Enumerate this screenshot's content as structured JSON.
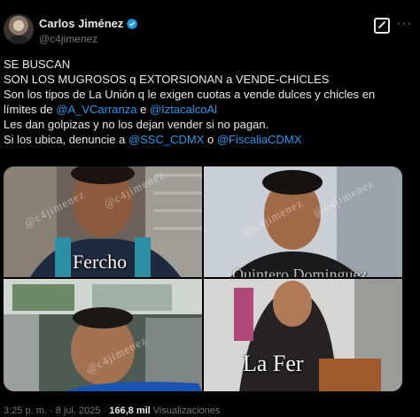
{
  "tweet": {
    "author": {
      "name": "Carlos Jiménez",
      "handle": "@c4jimenez"
    },
    "lines": [
      {
        "parts": [
          {
            "t": "SE BUSCAN",
            "link": false
          }
        ]
      },
      {
        "parts": [
          {
            "t": "SON LOS MUGROSOS q EXTORSIONAN a VENDE-CHICLES",
            "link": false
          }
        ]
      },
      {
        "parts": [
          {
            "t": "Son los tipos de La Unión q le exigen cuotas a vende dulces y chicles en",
            "link": false
          }
        ]
      },
      {
        "parts": [
          {
            "t": "límites de ",
            "link": false
          },
          {
            "t": "@A_VCarranza",
            "link": true
          },
          {
            "t": " e ",
            "link": false
          },
          {
            "t": "@IztacalcoAl",
            "link": true
          }
        ]
      },
      {
        "parts": [
          {
            "t": "Les dan golpizas y no los dejan vender si no pagan.",
            "link": false
          }
        ]
      },
      {
        "parts": [
          {
            "t": "Si los ubica, denuncie a ",
            "link": false
          },
          {
            "t": "@SSC_CDMX",
            "link": true
          },
          {
            "t": " o ",
            "link": false
          },
          {
            "t": "@FiscaliaCDMX",
            "link": true
          }
        ]
      }
    ],
    "photos": [
      {
        "caption": "Fercho",
        "watermark": "@c4jimenez"
      },
      {
        "caption": "Quintero Dominguez",
        "watermark": "@c4jimenez"
      },
      {
        "caption": "",
        "watermark": "@c4jimenez"
      },
      {
        "caption": "La Fer",
        "watermark": "@c4jimenez"
      }
    ],
    "meta": {
      "time": "3:25 p. m. · 8 jul. 2025 · ",
      "views": "166,8 mil",
      "views_label": " Visualizaciones"
    }
  },
  "icons": {
    "verified": "verified-badge-icon",
    "grok": "grok-icon",
    "more": "more-options-icon"
  },
  "colors": {
    "link": "#1d9bf0",
    "background": "#000000",
    "text": "#e7e9ea",
    "muted": "#71767b"
  }
}
